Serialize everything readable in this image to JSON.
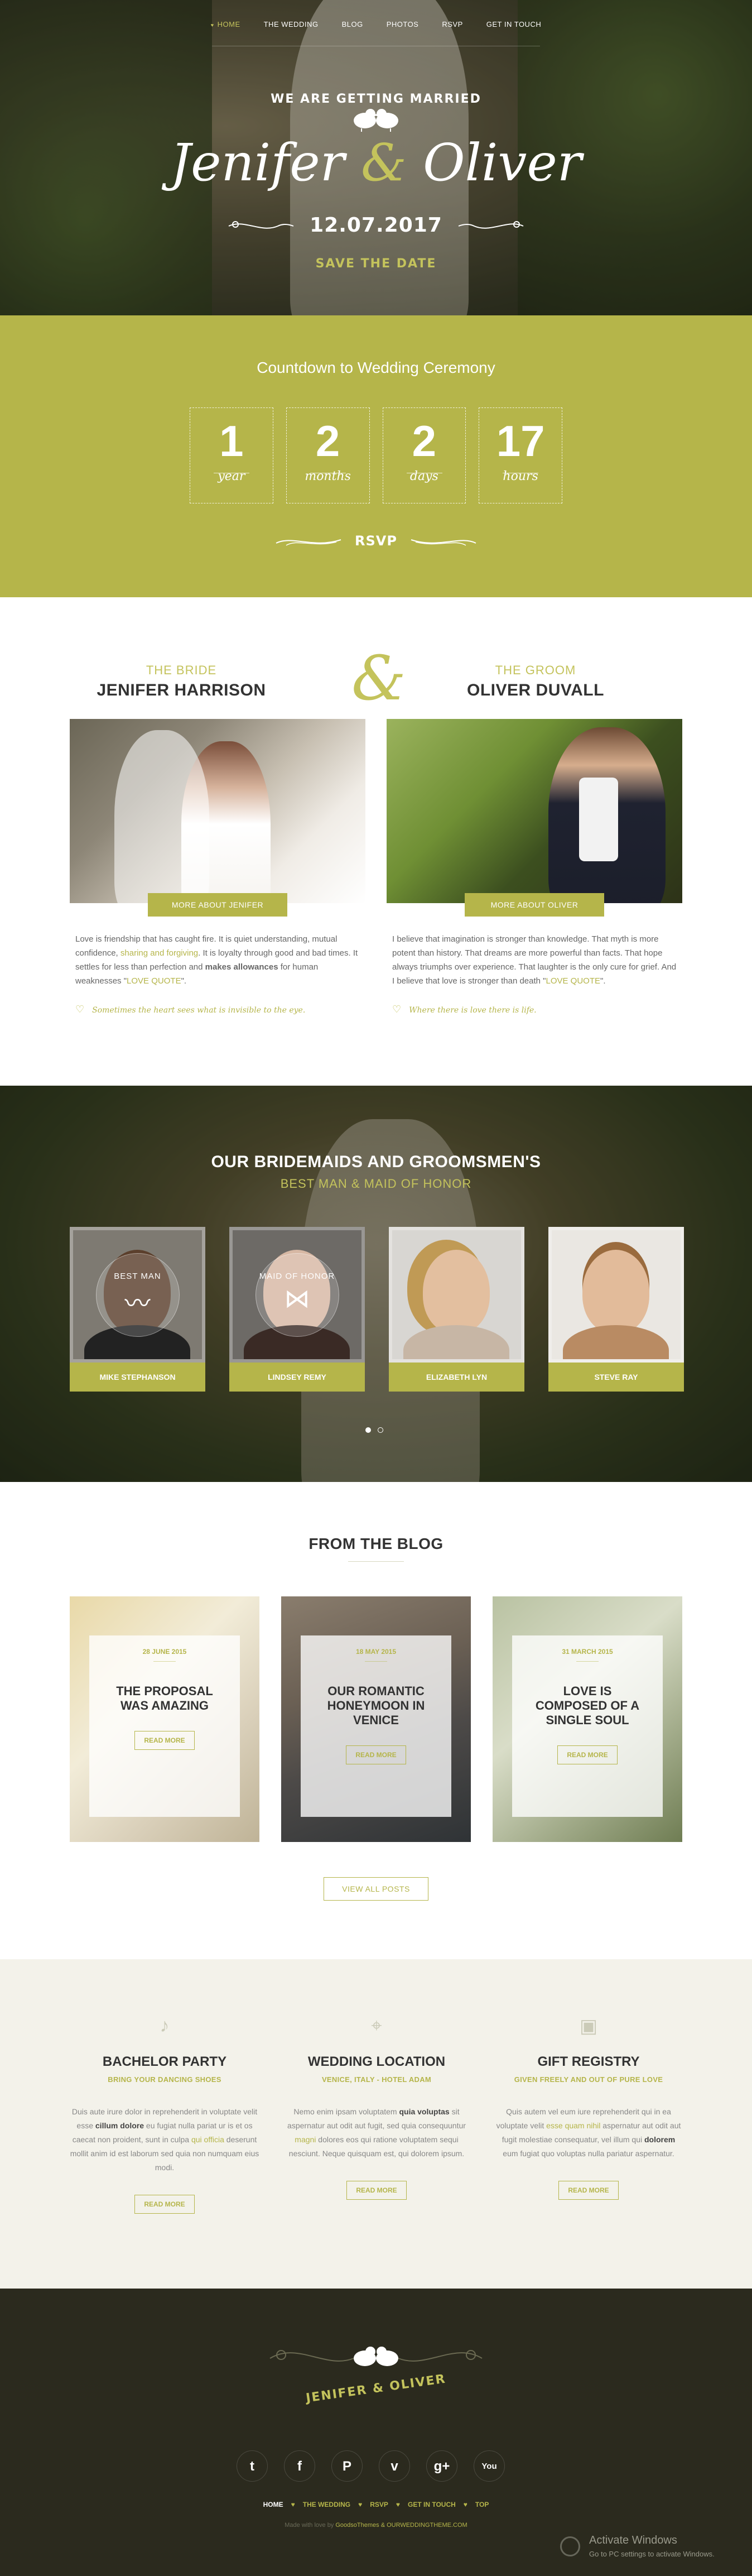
{
  "nav": {
    "items": [
      "HOME",
      "THE WEDDING",
      "BLOG",
      "PHOTOS",
      "RSVP",
      "GET IN TOUCH"
    ],
    "active": "HOME"
  },
  "hero": {
    "arc_text": "WE ARE GETTING MARRIED",
    "bride_name": "Jenifer",
    "amp": "&",
    "groom_name": "Oliver",
    "date": "12.07.2017",
    "save_the_date": "SAVE THE DATE"
  },
  "countdown": {
    "title": "Countdown to Wedding Ceremony",
    "boxes": [
      {
        "value": "1",
        "unit": "year"
      },
      {
        "value": "2",
        "unit": "months"
      },
      {
        "value": "2",
        "unit": "days"
      },
      {
        "value": "17",
        "unit": "hours"
      }
    ],
    "rsvp_label": "RSVP"
  },
  "couple": {
    "amp": "&",
    "bride": {
      "role": "THE BRIDE",
      "name": "JENIFER HARRISON",
      "button": "MORE ABOUT JENIFER",
      "text_1": "Love is friendship that has caught fire. It is quiet understanding, mutual confidence, ",
      "text_accent_1": "sharing and forgiving",
      "text_2": ". It is loyalty through good and bad times. It settles for less than perfection and ",
      "text_bold": "makes allowances",
      "text_3": " for human weaknesses \"",
      "text_accent_2": "LOVE QUOTE",
      "text_4": "\".",
      "quote": "Sometimes the heart sees what is invisible to the eye."
    },
    "groom": {
      "role": "THE GROOM",
      "name": "OLIVER DUVALL",
      "button": "MORE ABOUT OLIVER",
      "text_1": "I believe that imagination is stronger than knowledge. That myth is more potent than history. That dreams are more powerful than facts. That hope always triumphs over experience. That laughter is the only cure for grief. And I believe that love is stronger than death \"",
      "text_accent": "LOVE QUOTE",
      "text_2": "\".",
      "quote": "Where there is love there is life."
    }
  },
  "party": {
    "title": "OUR BRIDEMAIDS AND GROOMSMEN'S",
    "subtitle": "BEST MAN & MAID OF HONOR",
    "members": [
      {
        "name": "MIKE STEPHANSON",
        "badge": "BEST MAN",
        "badge_icon": "mustache-icon"
      },
      {
        "name": "LINDSEY REMY",
        "badge": "MAID OF HONOR",
        "badge_icon": "bow-icon"
      },
      {
        "name": "ELIZABETH LYN",
        "badge": "",
        "badge_icon": ""
      },
      {
        "name": "STEVE RAY",
        "badge": "",
        "badge_icon": ""
      }
    ]
  },
  "blog": {
    "title": "FROM THE BLOG",
    "posts": [
      {
        "date": "28 JUNE 2015",
        "title": "THE PROPOSAL WAS AMAZING",
        "button": "READ MORE"
      },
      {
        "date": "18 MAY 2015",
        "title": "OUR ROMANTIC HONEYMOON IN VENICE",
        "button": "READ MORE"
      },
      {
        "date": "31 MARCH 2015",
        "title": "LOVE IS COMPOSED OF A SINGLE SOUL",
        "button": "READ MORE"
      }
    ],
    "view_all": "VIEW ALL POSTS"
  },
  "info": {
    "cols": [
      {
        "icon": "music-note-icon",
        "title": "BACHELOR PARTY",
        "subtitle": "BRING YOUR DANCING SHOES",
        "t1": "Duis aute irure dolor in reprehenderit in voluptate velit esse ",
        "b1": "cillum dolore",
        "t2": " eu fugiat nulla pariat ur is et os caecat non proident, sunt in culpa ",
        "a1": "qui officia",
        "t3": " deserunt mollit anim id est laborum sed quia non numquam eius modi.",
        "button": "READ MORE"
      },
      {
        "icon": "map-pin-icon",
        "title": "WEDDING LOCATION",
        "subtitle": "VENICE, ITALY - HOTEL ADAM",
        "t1": "Nemo enim ipsam voluptatem ",
        "b1": "quia voluptas",
        "t2": " sit aspernatur aut odit aut fugit, sed quia consequuntur ",
        "a1": "magni",
        "t3": " dolores eos qui ratione voluptatem sequi nesciunt. Neque quisquam est, qui dolorem ipsum.",
        "button": "READ MORE"
      },
      {
        "icon": "gift-icon",
        "title": "GIFT REGISTRY",
        "subtitle": "GIVEN FREELY AND OUT OF PURE LOVE",
        "t1": "Quis autem vel eum iure reprehenderit qui in ea voluptate velit ",
        "a1": "esse quam nihil",
        "t2": " aspernatur aut odit aut fugit molestiae consequatur, vel illum qui ",
        "b1": "dolorem",
        "t3": " eum fugiat quo voluptas nulla pariatur aspernatur.",
        "button": "READ MORE"
      }
    ]
  },
  "footer": {
    "logo_text": "JENIFER & OLIVER",
    "socials": [
      "twitter-icon",
      "facebook-icon",
      "pinterest-icon",
      "vimeo-icon",
      "google-plus-icon",
      "youtube-icon"
    ],
    "social_glyphs": [
      "t",
      "f",
      "P",
      "v",
      "g+",
      "You"
    ],
    "nav": [
      "HOME",
      "THE WEDDING",
      "RSVP",
      "GET IN TOUCH",
      "TOP"
    ],
    "copy_prefix": "Made with love by ",
    "copy_link": "GoodsoThemes & OURWEDDINGTHEME.COM",
    "activate_title": "Activate Windows",
    "activate_sub": "Go to PC settings to activate Windows."
  },
  "colors": {
    "accent": "#b5b54a",
    "accent_light": "#c4c35c",
    "footer_bg": "#2b2a1e",
    "info_bg": "#f3f2ea"
  }
}
